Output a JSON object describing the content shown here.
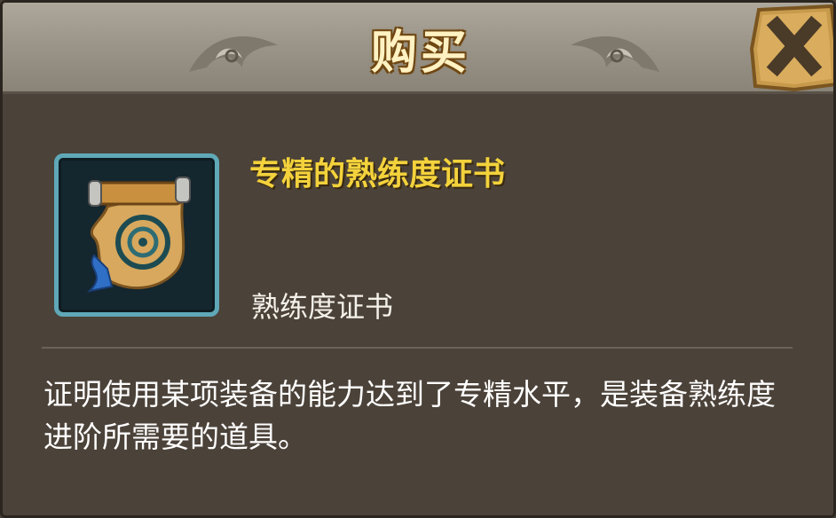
{
  "dialog": {
    "title": "购买",
    "close_icon": "close-x-icon"
  },
  "item": {
    "icon": "scroll-certificate-icon",
    "name": "专精的熟练度证书",
    "type": "熟练度证书",
    "description": "证明使用某项装备的能力达到了专精水平，是装备熟练度进阶所需要的道具。"
  },
  "colors": {
    "title": "#fff1c2",
    "item_name": "#f3d23c",
    "frame_border": "#5fa8b8",
    "background": "#4b4239"
  }
}
